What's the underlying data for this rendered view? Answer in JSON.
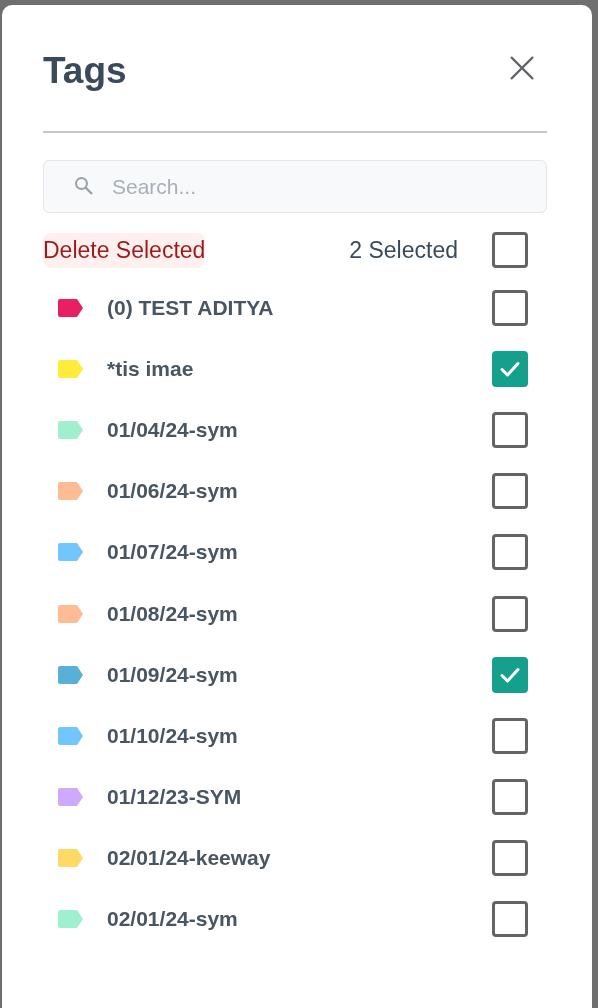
{
  "dialog": {
    "title": "Tags",
    "search": {
      "placeholder": "Search..."
    },
    "delete_label": "Delete Selected",
    "selected_count": "2 Selected",
    "select_all": {
      "checked": false
    }
  },
  "tags": [
    {
      "name": "(0) TEST ADITYA",
      "color": "#e91e63",
      "checked": false
    },
    {
      "name": "*tis imae",
      "color": "#ffeb3b",
      "checked": true
    },
    {
      "name": "01/04/24-sym",
      "color": "#a0f0cf",
      "checked": false
    },
    {
      "name": "01/06/24-sym",
      "color": "#ffbb93",
      "checked": false
    },
    {
      "name": "01/07/24-sym",
      "color": "#73c6fc",
      "checked": false
    },
    {
      "name": "01/08/24-sym",
      "color": "#ffbb93",
      "checked": false
    },
    {
      "name": "01/09/24-sym",
      "color": "#58b0d6",
      "checked": true
    },
    {
      "name": "01/10/24-sym",
      "color": "#73c6fc",
      "checked": false
    },
    {
      "name": "01/12/23-SYM",
      "color": "#cdaafd",
      "checked": false
    },
    {
      "name": "02/01/24-keeway",
      "color": "#ffd966",
      "checked": false
    },
    {
      "name": "02/01/24-sym",
      "color": "#a0f0cf",
      "checked": false
    }
  ]
}
